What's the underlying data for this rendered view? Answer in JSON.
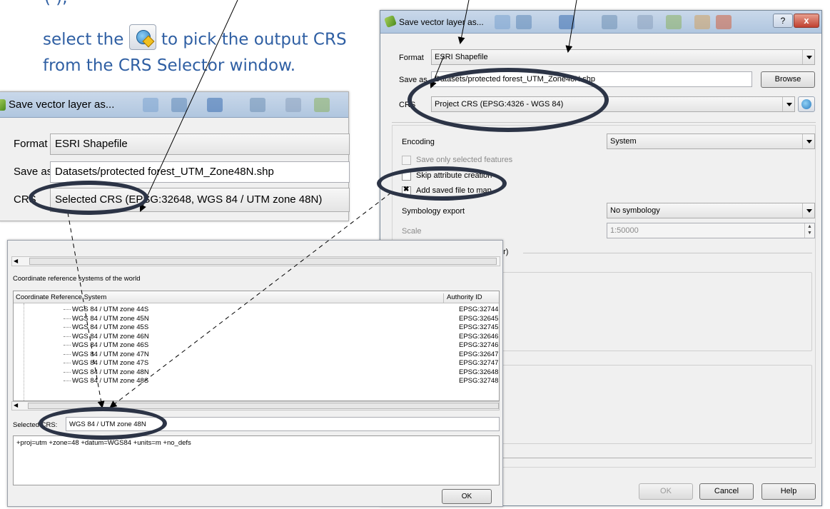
{
  "caption": {
    "line1": "select the",
    "line1b": "to pick the output CRS",
    "line2": "from the CRS Selector window."
  },
  "right_dialog": {
    "title": "Save vector layer as...",
    "format_label": "Format",
    "format_value": "ESRI Shapefile",
    "saveas_label": "Save as",
    "saveas_value": "Datasets/protected forest_UTM_Zone48N.shp",
    "browse_label": "Browse",
    "crs_label": "CRS",
    "crs_value": "Project CRS (EPSG:4326 - WGS 84)",
    "encoding_label": "Encoding",
    "encoding_value": "System",
    "save_only_selected": "Save only selected features",
    "skip_attr": "Skip attribute creation",
    "add_saved": "Add saved file to map",
    "symbology_label": "Symbology export",
    "symbology_value": "No symbology",
    "scale_label": "Scale",
    "scale_value": "1:50000",
    "group_fragment": "er)",
    "ok": "OK",
    "cancel": "Cancel",
    "help": "Help",
    "help_q": "?",
    "close_x": "x"
  },
  "left_dialog": {
    "title": "Save vector layer as...",
    "format_label": "Format",
    "format_value": "ESRI Shapefile",
    "saveas_label": "Save as",
    "saveas_value": "Datasets/protected forest_UTM_Zone48N.shp",
    "crs_label": "CRS",
    "crs_value": "Selected CRS (EPSG:32648, WGS 84 / UTM zone 48N)"
  },
  "crs_selector": {
    "world_label": "Coordinate reference systems of the world",
    "col_crs": "Coordinate Reference System",
    "col_auth": "Authority ID",
    "rows": [
      {
        "name": "WGS 84 / UTM zone 44S",
        "auth": "EPSG:32744"
      },
      {
        "name": "WGS 84 / UTM zone 45N",
        "auth": "EPSG:32645"
      },
      {
        "name": "WGS 84 / UTM zone 45S",
        "auth": "EPSG:32745"
      },
      {
        "name": "WGS 84 / UTM zone 46N",
        "auth": "EPSG:32646"
      },
      {
        "name": "WGS 84 / UTM zone 46S",
        "auth": "EPSG:32746"
      },
      {
        "name": "WGS 84 / UTM zone 47N",
        "auth": "EPSG:32647"
      },
      {
        "name": "WGS 84 / UTM zone 47S",
        "auth": "EPSG:32747"
      },
      {
        "name": "WGS 84 / UTM zone 48N",
        "auth": "EPSG:32648"
      },
      {
        "name": "WGS 84 / UTM zone 48S",
        "auth": "EPSG:32748"
      }
    ],
    "selected_label": "Selected CRS:",
    "selected_value": "WGS 84 / UTM zone 48N",
    "proj_string": "+proj=utm +zone=48 +datum=WGS84 +units=m +no_defs",
    "ok": "OK"
  }
}
